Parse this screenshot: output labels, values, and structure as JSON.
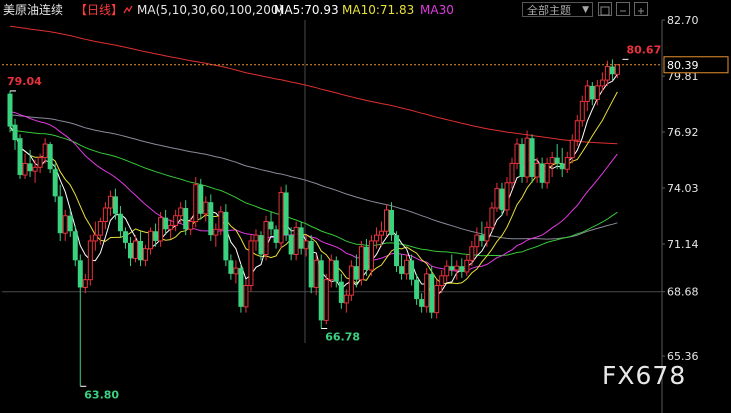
{
  "header": {
    "instrument": "美原油连续",
    "period": "【日线】",
    "ma_label": "MA(5,10,30,60,100,200)",
    "ma5_label": "MA5:70.93",
    "ma10_label": "MA10:71.83",
    "ma30_label": "MA30",
    "theme_select": "全部主题",
    "theme_arrow": "▼"
  },
  "watermark": "FX678",
  "colors": {
    "background": "#000000",
    "up": "#e8323c",
    "down": "#3ad17f",
    "ma5": "#ffffff",
    "ma10": "#e8e03a",
    "ma30": "#e03ae0",
    "ma60": "#37c837",
    "ma100": "#8a8a9a",
    "ma200": "#e03030",
    "price_line": "#e89030",
    "axis_text": "#e6e6e6"
  },
  "chart_data": {
    "type": "candlestick",
    "y_axis": {
      "min": 63.0,
      "max": 82.7,
      "ticks": [
        "82.70",
        "79.81",
        "76.92",
        "74.03",
        "71.14",
        "68.68",
        "65.36"
      ],
      "tick_values": [
        82.7,
        79.81,
        76.92,
        74.03,
        71.14,
        68.68,
        65.36
      ]
    },
    "current_price_label": "80.39",
    "current_price": 80.39,
    "annotations": [
      {
        "text": "79.04",
        "value": 79.04,
        "bar": 0,
        "color": "#e8323c"
      },
      {
        "text": "63.80",
        "value": 63.8,
        "bar": 14,
        "color": "#3ad17f"
      },
      {
        "text": "66.78",
        "value": 66.78,
        "bar": 62,
        "color": "#3ad17f"
      },
      {
        "text": "80.67",
        "value": 80.67,
        "bar": 122,
        "color": "#e8323c"
      }
    ],
    "candles": [
      [
        78.9,
        79.04,
        76.9,
        77.2
      ],
      [
        77.3,
        77.6,
        76.0,
        76.5
      ],
      [
        76.6,
        76.8,
        74.5,
        74.7
      ],
      [
        74.7,
        75.8,
        74.5,
        75.3
      ],
      [
        75.3,
        76.0,
        74.6,
        74.9
      ],
      [
        74.9,
        75.5,
        74.3,
        75.1
      ],
      [
        75.1,
        75.8,
        74.8,
        75.6
      ],
      [
        75.6,
        76.6,
        75.3,
        76.3
      ],
      [
        76.3,
        76.4,
        74.8,
        75.0
      ],
      [
        75.0,
        75.3,
        73.3,
        73.6
      ],
      [
        73.6,
        74.2,
        71.3,
        71.7
      ],
      [
        71.7,
        72.9,
        71.3,
        72.6
      ],
      [
        72.6,
        72.9,
        71.5,
        71.8
      ],
      [
        71.8,
        72.1,
        70.0,
        70.3
      ],
      [
        70.3,
        70.6,
        63.8,
        68.9
      ],
      [
        68.9,
        69.6,
        68.6,
        69.3
      ],
      [
        69.3,
        71.6,
        69.0,
        71.3
      ],
      [
        71.3,
        72.3,
        70.8,
        71.6
      ],
      [
        71.6,
        72.5,
        71.1,
        72.3
      ],
      [
        72.3,
        73.3,
        71.9,
        73.0
      ],
      [
        73.0,
        73.9,
        72.6,
        73.6
      ],
      [
        73.6,
        74.0,
        72.4,
        72.7
      ],
      [
        72.7,
        73.1,
        71.5,
        71.8
      ],
      [
        71.8,
        72.0,
        70.9,
        71.2
      ],
      [
        71.2,
        71.5,
        70.0,
        70.4
      ],
      [
        70.4,
        71.6,
        70.2,
        71.3
      ],
      [
        71.3,
        71.8,
        70.0,
        70.3
      ],
      [
        70.3,
        71.1,
        70.0,
        70.9
      ],
      [
        70.9,
        72.0,
        70.6,
        71.8
      ],
      [
        71.8,
        72.2,
        71.0,
        71.3
      ],
      [
        71.3,
        72.8,
        71.0,
        72.5
      ],
      [
        72.5,
        72.9,
        71.6,
        71.9
      ],
      [
        71.9,
        72.4,
        71.4,
        72.1
      ],
      [
        72.1,
        72.9,
        71.8,
        72.6
      ],
      [
        72.6,
        73.3,
        72.2,
        73.0
      ],
      [
        73.0,
        73.4,
        71.6,
        71.9
      ],
      [
        71.9,
        72.5,
        71.6,
        72.3
      ],
      [
        72.3,
        74.6,
        72.0,
        74.2
      ],
      [
        74.2,
        74.5,
        72.4,
        72.7
      ],
      [
        72.7,
        73.6,
        72.3,
        73.3
      ],
      [
        73.3,
        73.7,
        71.3,
        71.6
      ],
      [
        71.6,
        72.2,
        71.0,
        71.9
      ],
      [
        71.9,
        73.1,
        71.6,
        72.8
      ],
      [
        72.8,
        73.2,
        70.0,
        70.3
      ],
      [
        70.3,
        70.6,
        69.3,
        69.6
      ],
      [
        69.6,
        70.3,
        69.1,
        69.9
      ],
      [
        69.9,
        70.1,
        67.6,
        67.9
      ],
      [
        67.9,
        69.3,
        67.6,
        69.0
      ],
      [
        69.0,
        71.6,
        68.7,
        71.3
      ],
      [
        71.3,
        71.9,
        70.8,
        71.6
      ],
      [
        71.6,
        71.8,
        70.3,
        70.6
      ],
      [
        70.6,
        72.6,
        70.3,
        72.3
      ],
      [
        72.3,
        72.8,
        71.6,
        71.9
      ],
      [
        71.9,
        72.1,
        70.9,
        71.2
      ],
      [
        71.2,
        74.1,
        70.9,
        73.8
      ],
      [
        73.8,
        74.2,
        71.3,
        71.6
      ],
      [
        71.6,
        72.0,
        70.3,
        70.6
      ],
      [
        70.6,
        72.3,
        70.3,
        72.0
      ],
      [
        72.0,
        72.3,
        70.6,
        70.9
      ],
      [
        70.9,
        71.6,
        70.5,
        71.3
      ],
      [
        71.3,
        71.6,
        68.6,
        68.9
      ],
      [
        68.9,
        70.6,
        68.5,
        70.3
      ],
      [
        70.3,
        70.6,
        66.78,
        67.2
      ],
      [
        67.2,
        69.6,
        67.0,
        69.3
      ],
      [
        69.3,
        70.6,
        68.9,
        70.3
      ],
      [
        70.3,
        70.5,
        68.9,
        69.2
      ],
      [
        69.2,
        69.6,
        67.8,
        68.1
      ],
      [
        68.1,
        68.8,
        67.6,
        68.5
      ],
      [
        68.5,
        70.3,
        68.2,
        70.0
      ],
      [
        70.0,
        70.6,
        68.9,
        69.3
      ],
      [
        69.3,
        71.3,
        69.0,
        71.0
      ],
      [
        71.0,
        71.4,
        69.5,
        69.8
      ],
      [
        69.8,
        71.6,
        69.5,
        71.3
      ],
      [
        71.3,
        72.0,
        70.9,
        71.6
      ],
      [
        71.6,
        72.3,
        71.0,
        71.8
      ],
      [
        71.8,
        73.2,
        71.5,
        72.9
      ],
      [
        72.9,
        73.3,
        71.3,
        71.6
      ],
      [
        71.6,
        71.8,
        69.7,
        70.0
      ],
      [
        70.0,
        70.6,
        69.3,
        69.6
      ],
      [
        69.6,
        70.6,
        69.3,
        70.3
      ],
      [
        70.3,
        70.6,
        69.0,
        69.3
      ],
      [
        69.3,
        69.6,
        68.0,
        68.3
      ],
      [
        68.3,
        68.6,
        67.6,
        67.9
      ],
      [
        67.9,
        69.9,
        67.6,
        69.6
      ],
      [
        69.6,
        70.0,
        67.3,
        67.6
      ],
      [
        67.6,
        69.3,
        67.3,
        69.0
      ],
      [
        69.0,
        69.8,
        68.6,
        69.5
      ],
      [
        69.5,
        70.3,
        69.2,
        70.0
      ],
      [
        70.0,
        70.6,
        69.5,
        69.8
      ],
      [
        69.8,
        70.3,
        69.3,
        70.0
      ],
      [
        70.0,
        70.4,
        69.4,
        69.7
      ],
      [
        69.7,
        70.6,
        69.5,
        70.3
      ],
      [
        70.3,
        71.3,
        70.0,
        71.0
      ],
      [
        71.0,
        72.0,
        70.6,
        71.6
      ],
      [
        71.6,
        72.3,
        71.0,
        71.3
      ],
      [
        71.3,
        72.3,
        71.0,
        72.0
      ],
      [
        72.0,
        73.3,
        71.8,
        73.0
      ],
      [
        73.0,
        74.3,
        72.8,
        74.0
      ],
      [
        74.0,
        74.3,
        72.6,
        72.9
      ],
      [
        72.9,
        74.6,
        72.6,
        74.3
      ],
      [
        74.3,
        75.6,
        74.0,
        75.3
      ],
      [
        75.3,
        76.6,
        75.0,
        76.3
      ],
      [
        76.3,
        76.6,
        74.3,
        74.6
      ],
      [
        74.6,
        77.0,
        74.3,
        76.6
      ],
      [
        76.6,
        76.8,
        74.3,
        74.6
      ],
      [
        74.6,
        75.6,
        74.3,
        75.3
      ],
      [
        75.3,
        75.6,
        74.0,
        74.3
      ],
      [
        74.3,
        75.6,
        74.0,
        75.3
      ],
      [
        75.3,
        75.9,
        74.6,
        75.6
      ],
      [
        75.6,
        76.3,
        75.0,
        75.3
      ],
      [
        75.3,
        76.1,
        74.6,
        75.0
      ],
      [
        75.0,
        75.9,
        74.8,
        75.6
      ],
      [
        75.6,
        76.8,
        75.3,
        76.5
      ],
      [
        76.5,
        77.8,
        76.2,
        77.5
      ],
      [
        77.5,
        78.8,
        77.2,
        78.5
      ],
      [
        78.5,
        79.6,
        78.0,
        79.3
      ],
      [
        79.3,
        79.5,
        78.3,
        78.6
      ],
      [
        78.6,
        79.6,
        78.3,
        79.3
      ],
      [
        79.3,
        80.0,
        79.0,
        79.6
      ],
      [
        79.6,
        80.6,
        79.3,
        80.3
      ],
      [
        80.3,
        80.67,
        79.6,
        79.9
      ],
      [
        79.9,
        80.4,
        79.7,
        80.39
      ]
    ]
  }
}
